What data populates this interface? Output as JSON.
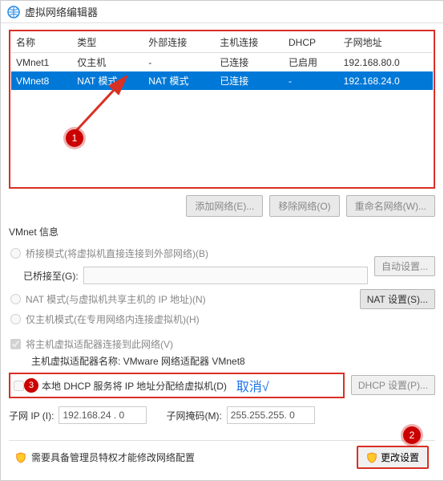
{
  "window": {
    "title": "虚拟网络编辑器"
  },
  "table": {
    "headers": {
      "name": "名称",
      "type": "类型",
      "external": "外部连接",
      "host": "主机连接",
      "dhcp": "DHCP",
      "subnet": "子网地址"
    },
    "rows": {
      "r0": {
        "name": "VMnet1",
        "type": "仅主机",
        "external": "-",
        "host": "已连接",
        "dhcp": "已启用",
        "subnet": "192.168.80.0"
      },
      "r1": {
        "name": "VMnet8",
        "type": "NAT 模式",
        "external": "NAT 模式",
        "host": "已连接",
        "dhcp": "-",
        "subnet": "192.168.24.0"
      }
    }
  },
  "buttons": {
    "add": "添加网络(E)...",
    "remove": "移除网络(O)",
    "rename": "重命名网络(W)...",
    "auto": "自动设置...",
    "nat": "NAT 设置(S)...",
    "dhcp": "DHCP 设置(P)...",
    "change": "更改设置"
  },
  "info": {
    "section_title": "VMnet 信息",
    "bridge_radio": "桥接模式(将虚拟机直接连接到外部网络)(B)",
    "bridge_to_label": "已桥接至(G):",
    "bridge_to_value": "",
    "nat_radio": "NAT 模式(与虚拟机共享主机的 IP 地址)(N)",
    "host_radio": "仅主机模式(在专用网络内连接虚拟机)(H)",
    "adapter_check": "将主机虚拟适配器连接到此网络(V)",
    "adapter_name_label": "主机虚拟适配器名称: VMware 网络适配器 VMnet8",
    "dhcp_check": "本地 DHCP 服务将 IP 地址分配给虚拟机(D)"
  },
  "subnet": {
    "ip_label": "子网 IP (I):",
    "ip_value": "192.168.24 . 0",
    "mask_label": "子网掩码(M):",
    "mask_value": "255.255.255. 0"
  },
  "footer": {
    "warn_text": "需要具备管理员特权才能修改网络配置"
  },
  "annotations": {
    "marker1": "1",
    "marker2": "2",
    "marker3": "3",
    "cancel": "取消√"
  }
}
